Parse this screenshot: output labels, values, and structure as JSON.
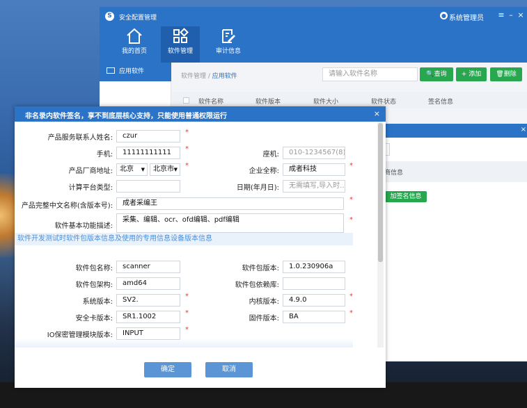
{
  "app": {
    "title": "安全配置管理",
    "user": "系统管理员",
    "nav": [
      {
        "label": "我的首页"
      },
      {
        "label": "软件管理"
      },
      {
        "label": "审计信息"
      }
    ],
    "sidebar": {
      "active_item": "应用软件"
    },
    "breadcrumb": {
      "parent": "软件管理 /",
      "current": "应用软件"
    },
    "search": {
      "placeholder": "请输入软件名称"
    },
    "buttons": {
      "query": "查询",
      "add": "+ 添加",
      "delete": "删除"
    },
    "table": {
      "headers": [
        "软件名称",
        "软件版本",
        "软件大小",
        "软件状态",
        "签名信息"
      ]
    }
  },
  "bg_dialog": {
    "band_text": "商信息",
    "button": "加签名信息"
  },
  "modal": {
    "title": "非名录内软件签名，享不到底层核心支持，只能使用普通权限运行",
    "fields": {
      "contact_name": {
        "label": "产品服务联系人姓名:",
        "value": "czur"
      },
      "phone": {
        "label": "手机:",
        "value": "11111111111"
      },
      "landline": {
        "label": "座机:",
        "placeholder": "010-1234567(8)"
      },
      "address": {
        "label": "产品厂商地址:",
        "province": "北京",
        "city": "北京市"
      },
      "company": {
        "label": "企业全称:",
        "value": "成者科技"
      },
      "platform": {
        "label": "计算平台类型:",
        "value": ""
      },
      "date": {
        "label": "日期(年月日):",
        "placeholder": "无需填写,导入时..."
      },
      "product_name": {
        "label": "产品完整中文名称(含版本号):",
        "value": "成者采编王"
      },
      "description": {
        "label": "软件基本功能描述:",
        "value": "采集、编辑、ocr、ofd编辑、pdf编辑"
      },
      "pkg_name": {
        "label": "软件包名称:",
        "value": "scanner"
      },
      "pkg_version": {
        "label": "软件包版本:",
        "value": "1.0.230906a"
      },
      "pkg_arch": {
        "label": "软件包架构:",
        "value": "amd64"
      },
      "pkg_deps": {
        "label": "软件包依赖库:",
        "value": ""
      },
      "sys_version": {
        "label": "系统版本:",
        "value": "SV2."
      },
      "kernel_version": {
        "label": "内核版本:",
        "value": "4.9.0"
      },
      "seccard_version": {
        "label": "安全卡版本:",
        "value": "SR1.1002"
      },
      "firmware_version": {
        "label": "固件版本:",
        "value": "BA"
      },
      "io_module_version": {
        "label": "IO保密管理模块版本:",
        "value": "INPUT"
      }
    },
    "section_title": "软件开发测试时软件包版本信息及使用的专用信息设备版本信息",
    "buttons": {
      "confirm": "确定",
      "cancel": "取消"
    }
  }
}
